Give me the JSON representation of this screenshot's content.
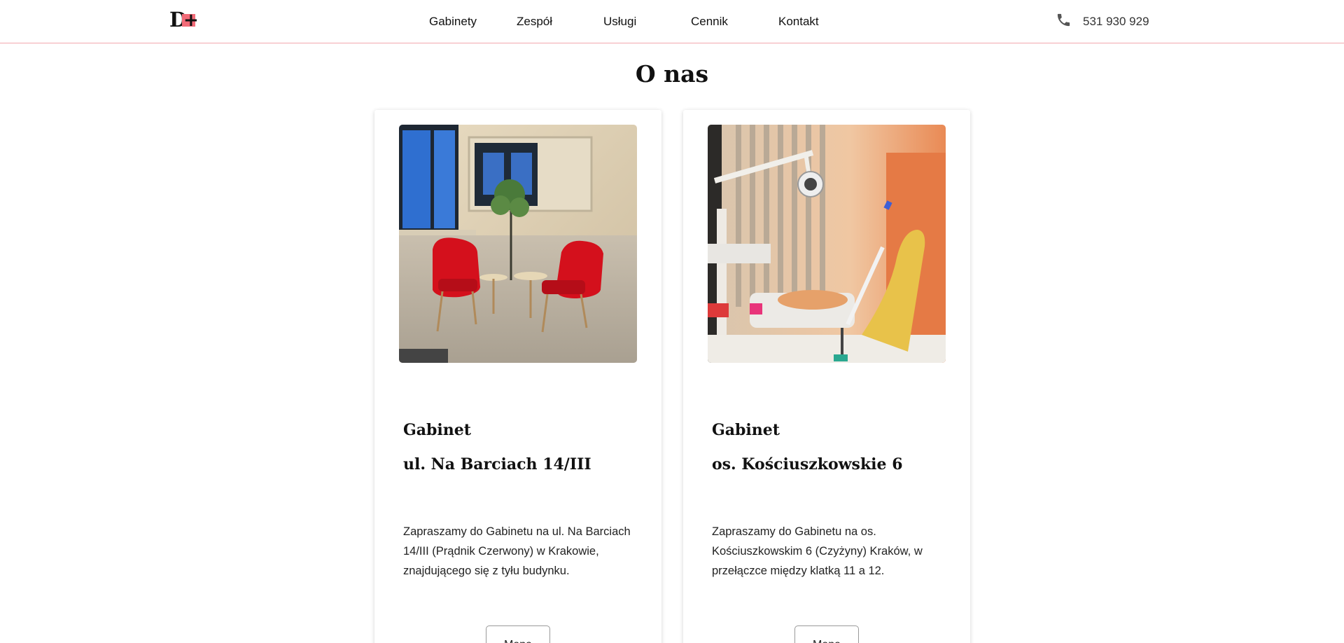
{
  "brand": {
    "logo_letter": "D",
    "logo_symbol": "+"
  },
  "nav": {
    "items": [
      {
        "label": "Gabinety"
      },
      {
        "label": "Zespół"
      },
      {
        "label": "Usługi"
      },
      {
        "label": "Cennik"
      },
      {
        "label": "Kontakt"
      }
    ]
  },
  "contact": {
    "icon": "phone-icon",
    "phone": "531 930 929"
  },
  "section": {
    "title": "O nas"
  },
  "colors": {
    "accent": "#f26b78",
    "header_border": "#f3a8ae",
    "chair_red": "#d4101c"
  },
  "cards": [
    {
      "title_line1": "Gabinet",
      "title_line2": "ul. Na Barciach 14/III",
      "description": "Zapraszamy do Gabinetu na ul. Na Barciach 14/III (Prądnik Czerwony) w Krakowie, znajdującego się z tyłu budynku.",
      "button_label": "Mapa"
    },
    {
      "title_line1": "Gabinet",
      "title_line2": "os. Kościuszkowskie 6",
      "description": "Zapraszamy do Gabinetu na os. Kościuszkowskim 6 (Czyżyny) Kraków, w przełączce między klatką 11 a 12.",
      "button_label": "Mapa"
    }
  ]
}
